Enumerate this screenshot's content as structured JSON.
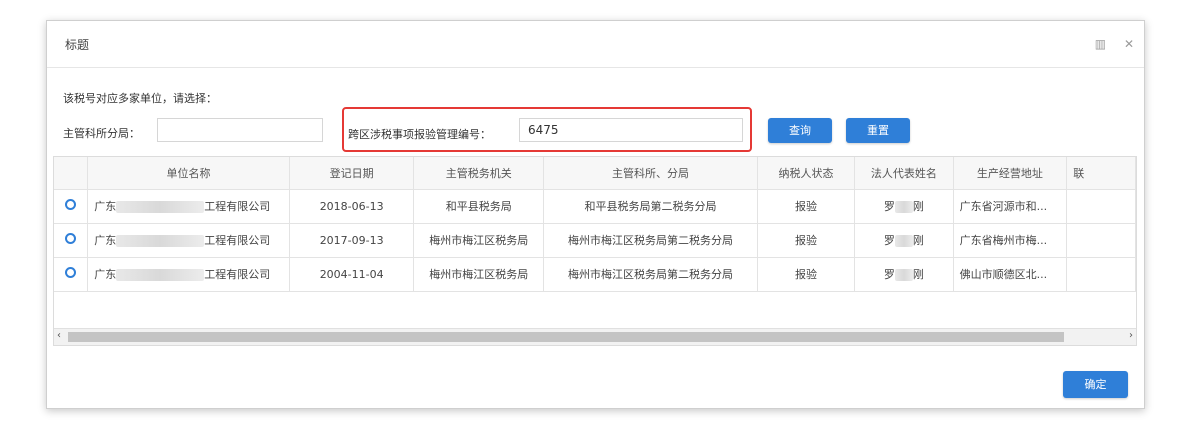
{
  "dialog": {
    "title": "标题",
    "prompt": "该税号对应多家单位，请选择：",
    "icons": [
      "maximize-icon",
      "close-icon"
    ]
  },
  "form": {
    "office_label": "主管科所分局：",
    "office_value": "",
    "cross_region_label": "跨区涉税事项报验管理编号：",
    "cross_region_value": "6475",
    "query_button": "查询",
    "reset_button": "重置"
  },
  "table": {
    "columns": [
      "单位名称",
      "登记日期",
      "主管税务机关",
      "主管科所、分局",
      "纳税人状态",
      "法人代表姓名",
      "生产经营地址",
      "联"
    ],
    "rows": [
      {
        "name_prefix": "广东",
        "name_suffix": "工程有限公司",
        "date": "2018-06-13",
        "authority": "和平县税务局",
        "branch": "和平县税务局第二税务分局",
        "status": "报验",
        "rep_prefix": "罗",
        "rep_suffix": "刚",
        "address": "广东省河源市和..."
      },
      {
        "name_prefix": "广东",
        "name_suffix": "工程有限公司",
        "date": "2017-09-13",
        "authority": "梅州市梅江区税务局",
        "branch": "梅州市梅江区税务局第二税务分局",
        "status": "报验",
        "rep_prefix": "罗",
        "rep_suffix": "刚",
        "address": "广东省梅州市梅..."
      },
      {
        "name_prefix": "广东",
        "name_suffix": "工程有限公司",
        "date": "2004-11-04",
        "authority": "梅州市梅江区税务局",
        "branch": "梅州市梅江区税务局第二税务分局",
        "status": "报验",
        "rep_prefix": "罗",
        "rep_suffix": "刚",
        "address": "佛山市顺德区北..."
      }
    ]
  },
  "footer": {
    "confirm_button": "确定"
  },
  "colors": {
    "accent": "#2f7fd8",
    "highlight": "#e53935"
  }
}
